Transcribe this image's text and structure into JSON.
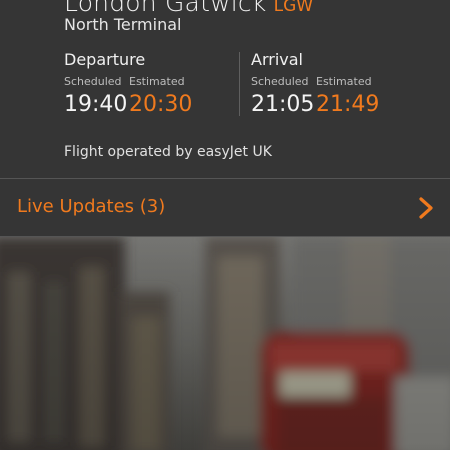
{
  "flight": {
    "airport_name": "London Gatwick",
    "airport_code": "LGW",
    "terminal": "North Terminal",
    "departure": {
      "title": "Departure",
      "scheduled_label": "Scheduled",
      "estimated_label": "Estimated",
      "scheduled_time": "19:40",
      "estimated_time": "20:30"
    },
    "arrival": {
      "title": "Arrival",
      "scheduled_label": "Scheduled",
      "estimated_label": "Estimated",
      "scheduled_time": "21:05",
      "estimated_time": "21:49"
    },
    "operated_by": "Flight operated by easyJet UK"
  },
  "live_updates": {
    "label": "Live Updates (3)",
    "icon": "chevron-right-icon"
  },
  "colors": {
    "background": "#353535",
    "accent": "#f07a1e",
    "text": "#f2f2f2",
    "muted": "#bdbdbd"
  }
}
